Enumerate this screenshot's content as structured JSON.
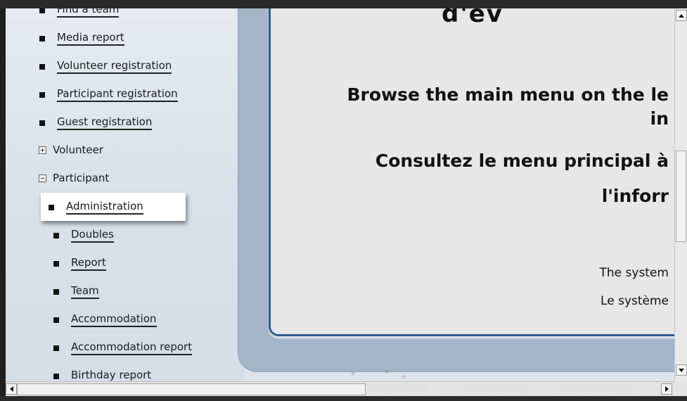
{
  "sidebar": {
    "items": [
      {
        "label": "Find a team",
        "type": "link"
      },
      {
        "label": "Media report",
        "type": "link"
      },
      {
        "label": "Volunteer registration",
        "type": "link"
      },
      {
        "label": "Participant registration",
        "type": "link"
      },
      {
        "label": "Guest registration",
        "type": "link"
      },
      {
        "label": "Volunteer",
        "type": "folder",
        "state": "collapsed"
      },
      {
        "label": "Participant",
        "type": "folder",
        "state": "expanded"
      },
      {
        "label": "Administration",
        "type": "link",
        "highlighted": true
      },
      {
        "label": "Doubles",
        "type": "link"
      },
      {
        "label": "Report",
        "type": "link"
      },
      {
        "label": "Team",
        "type": "link"
      },
      {
        "label": "Accommodation",
        "type": "link"
      },
      {
        "label": "Accommodation report",
        "type": "link"
      },
      {
        "label": "Birthday report",
        "type": "link"
      }
    ]
  },
  "content": {
    "title_fragment": "d'ev",
    "line1": "Browse the main menu on the le",
    "line2": "in",
    "line3": "Consultez le menu principal à",
    "line4": "l'inforr",
    "line5": "The system",
    "line6": "Le système"
  },
  "colors": {
    "card_border": "#2f5a8c",
    "frame": "#a5b5c9"
  }
}
